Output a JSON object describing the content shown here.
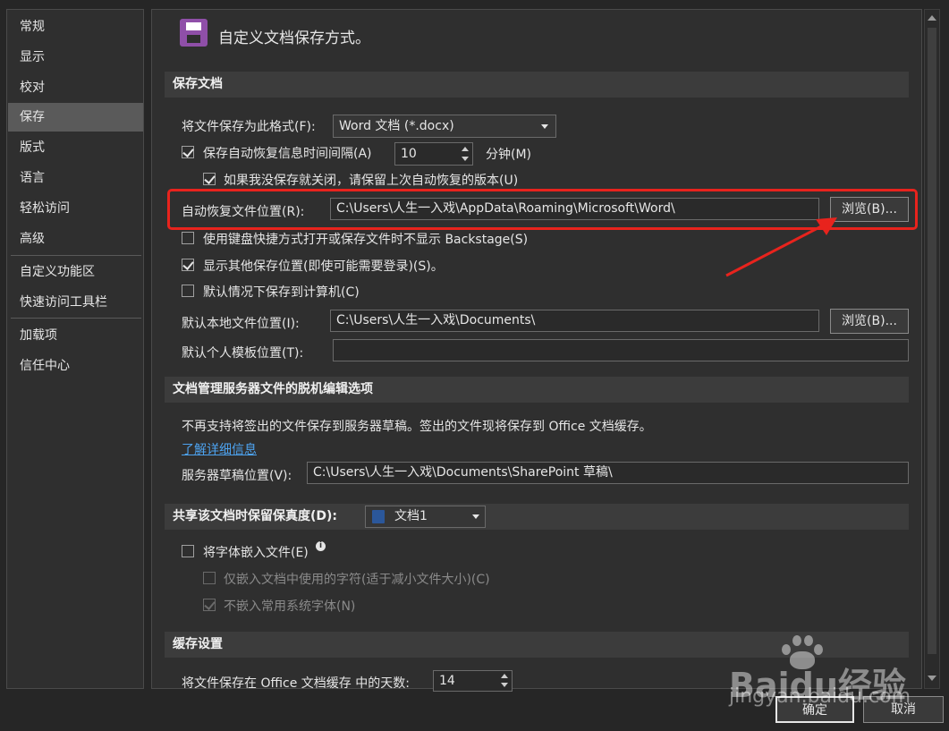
{
  "nav": {
    "items": [
      "常规",
      "显示",
      "校对",
      "保存",
      "版式",
      "语言",
      "轻松访问",
      "高级",
      "自定义功能区",
      "快速访问工具栏",
      "加载项",
      "信任中心"
    ],
    "selected": "保存"
  },
  "header": {
    "title": "自定义文档保存方式。",
    "icon": "floppy-disk-icon"
  },
  "save_docs": {
    "section_title": "保存文档",
    "format_label": "将文件保存为此格式(F):",
    "format_value": "Word 文档 (*.docx)",
    "autorecover_label": "保存自动恢复信息时间间隔(A)",
    "autorecover_value": "10",
    "minutes_label": "分钟(M)",
    "keep_last_label": "如果我没保存就关闭，请保留上次自动恢复的版本(U)",
    "autorecover_loc_label": "自动恢复文件位置(R):",
    "autorecover_loc_value": "C:\\Users\\人生一入戏\\AppData\\Roaming\\Microsoft\\Word\\",
    "browse1": "浏览(B)...",
    "no_backstage_label": "使用键盘快捷方式打开或保存文件时不显示 Backstage(S)",
    "show_other_label": "显示其他保存位置(即使可能需要登录)(S)。",
    "save_computer_label": "默认情况下保存到计算机(C)",
    "local_loc_label": "默认本地文件位置(I):",
    "local_loc_value": "C:\\Users\\人生一入戏\\Documents\\",
    "browse2": "浏览(B)...",
    "template_loc_label": "默认个人模板位置(T):",
    "template_loc_value": ""
  },
  "offline": {
    "section_title": "文档管理服务器文件的脱机编辑选项",
    "notice": "不再支持将签出的文件保存到服务器草稿。签出的文件现将保存到 Office 文档缓存。",
    "learn_more": "了解详细信息",
    "drafts_label": "服务器草稿位置(V):",
    "drafts_value": "C:\\Users\\人生一入戏\\Documents\\SharePoint 草稿\\"
  },
  "fidelity": {
    "section_title": "共享该文档时保留保真度(D):",
    "doc_value": "文档1",
    "embed_fonts_label": "将字体嵌入文件(E)",
    "embed_used_label": "仅嵌入文档中使用的字符(适于减小文件大小)(C)",
    "no_common_label": "不嵌入常用系统字体(N)"
  },
  "cache": {
    "section_title": "缓存设置",
    "days_label": "将文件保存在 Office 文档缓存 中的天数:",
    "days_value": "14"
  },
  "footer": {
    "ok": "确定",
    "cancel": "取消"
  },
  "watermark": {
    "brand": "Baidu经验",
    "url": "jingyan.baidu.com"
  },
  "colors": {
    "highlight": "#e8231d",
    "link": "#4da3f0",
    "selected_nav": "#5a5a5a",
    "icon": "#8f4fa8"
  }
}
